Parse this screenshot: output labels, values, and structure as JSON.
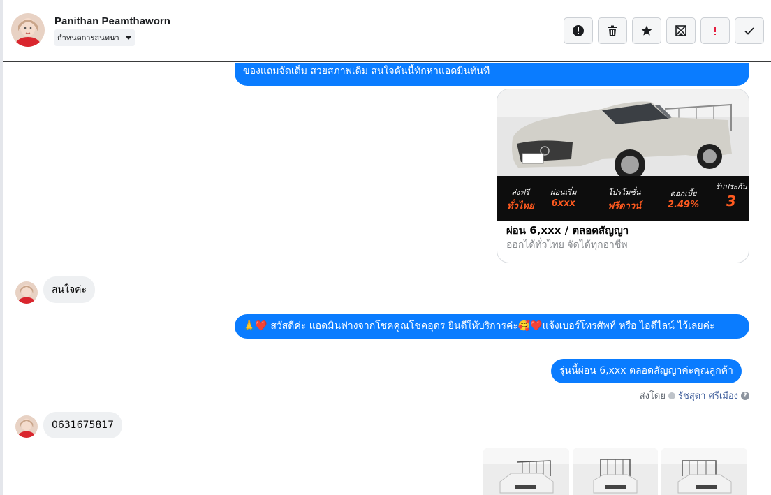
{
  "header": {
    "contact_name": "Panithan Peamthaworn",
    "label_dropdown": "กำหนดการสนทนา",
    "toolbar": [
      {
        "name": "exclamation-icon",
        "tooltip": ""
      },
      {
        "name": "trash-icon",
        "tooltip": ""
      },
      {
        "name": "star-icon",
        "tooltip": ""
      },
      {
        "name": "archive-mail-icon",
        "tooltip": ""
      },
      {
        "name": "spam-icon",
        "tooltip": ""
      },
      {
        "name": "check-icon",
        "tooltip": ""
      }
    ]
  },
  "messages": {
    "out_1_tail": "ของแถมจัดเต็ม สวยสภาพเดิม สนใจคันนี้ทักหาแอดมินทันที",
    "card": {
      "title": "ผ่อน 6,xxx / ตลอดสัญญา",
      "subtitle": "ออกได้ทั่วไทย จัดได้ทุกอาชีพ",
      "promo": [
        {
          "top": "ส่งฟรี",
          "bottom": "ทั่วไทย"
        },
        {
          "top": "ผ่อนเริ่ม",
          "bottom": "6xxx"
        },
        {
          "top": "โปรโมชั่น",
          "bottom": "ฟรีดาวน์"
        },
        {
          "top": "ดอกเบี้ย",
          "bottom": "2.49%"
        },
        {
          "top": "รับประกัน",
          "bottom": "3"
        }
      ]
    },
    "in_1": "สนใจค่ะ",
    "out_2": "🙏❤️ สวัสดีค่ะ แอดมินฟางจากโชคคูณโชคอุดร ยินดีให้บริการค่ะ🥰❤️แจ้งเบอร์โทรศัพท์ หรือ ไอดีไลน์  ไว้เลยค่ะ",
    "out_3": "รุ่นนี้ผ่อน 6,xxx ตลอดสัญญาค่ะคุณลูกค้า",
    "sent_by_label": "ส่งโดย",
    "sent_by_name": "รัชสุดา ศรีเมือง",
    "in_2": "0631675817"
  },
  "colors": {
    "outgoing_bubble": "#0a7cff",
    "incoming_bubble": "#eef0f2"
  }
}
